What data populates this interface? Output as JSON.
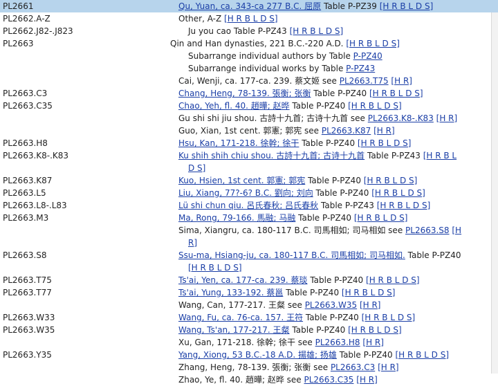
{
  "rows": [
    {
      "cn": "PL2661",
      "parts": [
        {
          "t": "Qu, Yuan, ca. 343-ca 277 B.C. 屈原",
          "link": true
        },
        {
          "t": " Table P-PZ39 "
        },
        {
          "t": "[H R B L D S]",
          "link": true
        }
      ],
      "sel": true,
      "indent": 258
    },
    {
      "cn": "PL2662.A-Z",
      "parts": [
        {
          "t": "Other, A-Z "
        },
        {
          "t": "[H R B L D S]",
          "link": true
        }
      ],
      "indent": 258
    },
    {
      "cn": "PL2662.J82-.J823",
      "parts": [
        {
          "t": "Ju you cao Table P-PZ43 "
        },
        {
          "t": "[H R B L D S]",
          "link": true
        }
      ],
      "indent": 272
    },
    {
      "cn": "PL2663",
      "parts": [
        {
          "t": "Qin and Han dynasties, 221 B.C.-220 A.D. "
        },
        {
          "t": "[H R B L D S]",
          "link": true
        }
      ],
      "indent": 246
    },
    {
      "cn": "",
      "parts": [
        {
          "t": "Subarrange individual authors by Table "
        },
        {
          "t": "P-PZ40",
          "link": true
        }
      ],
      "indent": 272
    },
    {
      "cn": "",
      "parts": [
        {
          "t": "Subarrange individual works by Table "
        },
        {
          "t": "P-PZ43",
          "link": true
        }
      ],
      "indent": 272
    },
    {
      "cn": "",
      "parts": [
        {
          "t": "Cai, Wenji, ca. 177-ca. 239. 蔡文姬 see "
        },
        {
          "t": "PL2663.T75",
          "link": true
        },
        {
          "t": " "
        },
        {
          "t": "[H R]",
          "link": true
        }
      ],
      "indent": 258
    },
    {
      "cn": "PL2663.C3",
      "parts": [
        {
          "t": "Chang, Heng, 78-139. 張衡; 张衡",
          "link": true
        },
        {
          "t": " Table P-PZ40 "
        },
        {
          "t": "[H R B L D S]",
          "link": true
        }
      ],
      "indent": 258
    },
    {
      "cn": "PL2663.C35",
      "parts": [
        {
          "t": "Chao, Yeh, fl. 40. 趙曄; 赵晔",
          "link": true
        },
        {
          "t": " Table P-PZ40 "
        },
        {
          "t": "[H R B L D S]",
          "link": true
        }
      ],
      "indent": 258
    },
    {
      "cn": "",
      "parts": [
        {
          "t": "Gu shi shi jiu shou. 古詩十九首; 古诗十九首 see "
        },
        {
          "t": "PL2663.K8-.K83",
          "link": true
        },
        {
          "t": " "
        },
        {
          "t": "[H R]",
          "link": true
        }
      ],
      "indent": 258
    },
    {
      "cn": "",
      "parts": [
        {
          "t": "Guo, Xian, 1st cent. 郭憲; 郭宪 see "
        },
        {
          "t": "PL2663.K87",
          "link": true
        },
        {
          "t": " "
        },
        {
          "t": "[H R]",
          "link": true
        }
      ],
      "indent": 258
    },
    {
      "cn": "PL2663.H8",
      "parts": [
        {
          "t": "Hsu, Kan, 171-218. 徐幹; 徐干",
          "link": true
        },
        {
          "t": " Table P-PZ40 "
        },
        {
          "t": "[H R B L D S]",
          "link": true
        }
      ],
      "indent": 258
    },
    {
      "cn": "PL2663.K8-.K83",
      "parts": [
        {
          "t": "Ku shih shih chiu shou. 古詩十九首; 古诗十九首",
          "link": true
        },
        {
          "t": " Table P-PZ43 "
        },
        {
          "t": "[H R B L",
          "link": true
        }
      ],
      "indent": 258
    },
    {
      "cn": "",
      "parts": [
        {
          "t": "D S]",
          "link": true
        }
      ],
      "indent": 272
    },
    {
      "cn": "PL2663.K87",
      "parts": [
        {
          "t": "Kuo, Hsien, 1st cent. 郭憲; 郭宪",
          "link": true
        },
        {
          "t": " Table P-PZ40 "
        },
        {
          "t": "[H R B L D S]",
          "link": true
        }
      ],
      "indent": 258
    },
    {
      "cn": "PL2663.L5",
      "parts": [
        {
          "t": "Liu, Xiang, 77?-6? B.C. 劉向; 刘向",
          "link": true
        },
        {
          "t": " Table P-PZ40 "
        },
        {
          "t": "[H R B L D S]",
          "link": true
        }
      ],
      "indent": 258
    },
    {
      "cn": "PL2663.L8-.L83",
      "parts": [
        {
          "t": "Lü shi chun qiu. 呂氏春秋; 吕氏春秋",
          "link": true
        },
        {
          "t": " Table P-PZ43 "
        },
        {
          "t": "[H R B L D S]",
          "link": true
        }
      ],
      "indent": 258
    },
    {
      "cn": "PL2663.M3",
      "parts": [
        {
          "t": "Ma, Rong, 79-166. 馬融; 马融",
          "link": true
        },
        {
          "t": " Table P-PZ40 "
        },
        {
          "t": "[H R B L D S]",
          "link": true
        }
      ],
      "indent": 258
    },
    {
      "cn": "",
      "parts": [
        {
          "t": "Sima, Xiangru, ca. 180-117 B.C. 司馬相如; 司马相如 see "
        },
        {
          "t": "PL2663.S8",
          "link": true
        },
        {
          "t": " "
        },
        {
          "t": "[H",
          "link": true
        }
      ],
      "indent": 258
    },
    {
      "cn": "",
      "parts": [
        {
          "t": "R]",
          "link": true
        }
      ],
      "indent": 272
    },
    {
      "cn": "PL2663.S8",
      "parts": [
        {
          "t": "Ssu-ma, Hsiang-ju, ca. 180-117 B.C. 司馬相如; 司马相如.",
          "link": true
        },
        {
          "t": " Table P-PZ40"
        }
      ],
      "indent": 258
    },
    {
      "cn": "",
      "parts": [
        {
          "t": "[H R B L D S]",
          "link": true
        }
      ],
      "indent": 272
    },
    {
      "cn": "PL2663.T75",
      "parts": [
        {
          "t": "Ts'ai, Yen, ca. 177-ca. 239. 蔡琰",
          "link": true
        },
        {
          "t": " Table P-PZ40 "
        },
        {
          "t": "[H R B L D S]",
          "link": true
        }
      ],
      "indent": 258
    },
    {
      "cn": "PL2663.T77",
      "parts": [
        {
          "t": "Ts'ai, Yung, 133-192. 蔡邕",
          "link": true
        },
        {
          "t": " Table P-PZ40 "
        },
        {
          "t": "[H R B L D S]",
          "link": true
        }
      ],
      "indent": 258
    },
    {
      "cn": "",
      "parts": [
        {
          "t": "Wang, Can, 177-217. 王粲 see "
        },
        {
          "t": "PL2663.W35",
          "link": true
        },
        {
          "t": " "
        },
        {
          "t": "[H R]",
          "link": true
        }
      ],
      "indent": 258
    },
    {
      "cn": "PL2663.W33",
      "parts": [
        {
          "t": "Wang, Fu, ca. 76-ca. 157. 王符",
          "link": true
        },
        {
          "t": " Table P-PZ40 "
        },
        {
          "t": "[H R B L D S]",
          "link": true
        }
      ],
      "indent": 258
    },
    {
      "cn": "PL2663.W35",
      "parts": [
        {
          "t": "Wang, Ts'an, 177-217. 王粲",
          "link": true
        },
        {
          "t": " Table P-PZ40 "
        },
        {
          "t": "[H R B L D S]",
          "link": true
        }
      ],
      "indent": 258
    },
    {
      "cn": "",
      "parts": [
        {
          "t": "Xu, Gan, 171-218. 徐幹; 徐干 see "
        },
        {
          "t": "PL2663.H8",
          "link": true
        },
        {
          "t": " "
        },
        {
          "t": "[H R]",
          "link": true
        }
      ],
      "indent": 258
    },
    {
      "cn": "PL2663.Y35",
      "parts": [
        {
          "t": "Yang, Xiong, 53 B.C.-18 A.D. 揚雄; 扬雄",
          "link": true
        },
        {
          "t": " Table P-PZ40 "
        },
        {
          "t": "[H R B L D S]",
          "link": true
        }
      ],
      "indent": 258
    },
    {
      "cn": "",
      "parts": [
        {
          "t": "Zhang, Heng, 78-139. 張衡; 张衡 see "
        },
        {
          "t": "PL2663.C3",
          "link": true
        },
        {
          "t": " "
        },
        {
          "t": "[H R]",
          "link": true
        }
      ],
      "indent": 258
    },
    {
      "cn": "",
      "parts": [
        {
          "t": "Zhao, Ye, fl. 40. 趙曄; 赵晔 see "
        },
        {
          "t": "PL2663.C35",
          "link": true
        },
        {
          "t": " "
        },
        {
          "t": "[H R]",
          "link": true
        }
      ],
      "indent": 258
    }
  ]
}
